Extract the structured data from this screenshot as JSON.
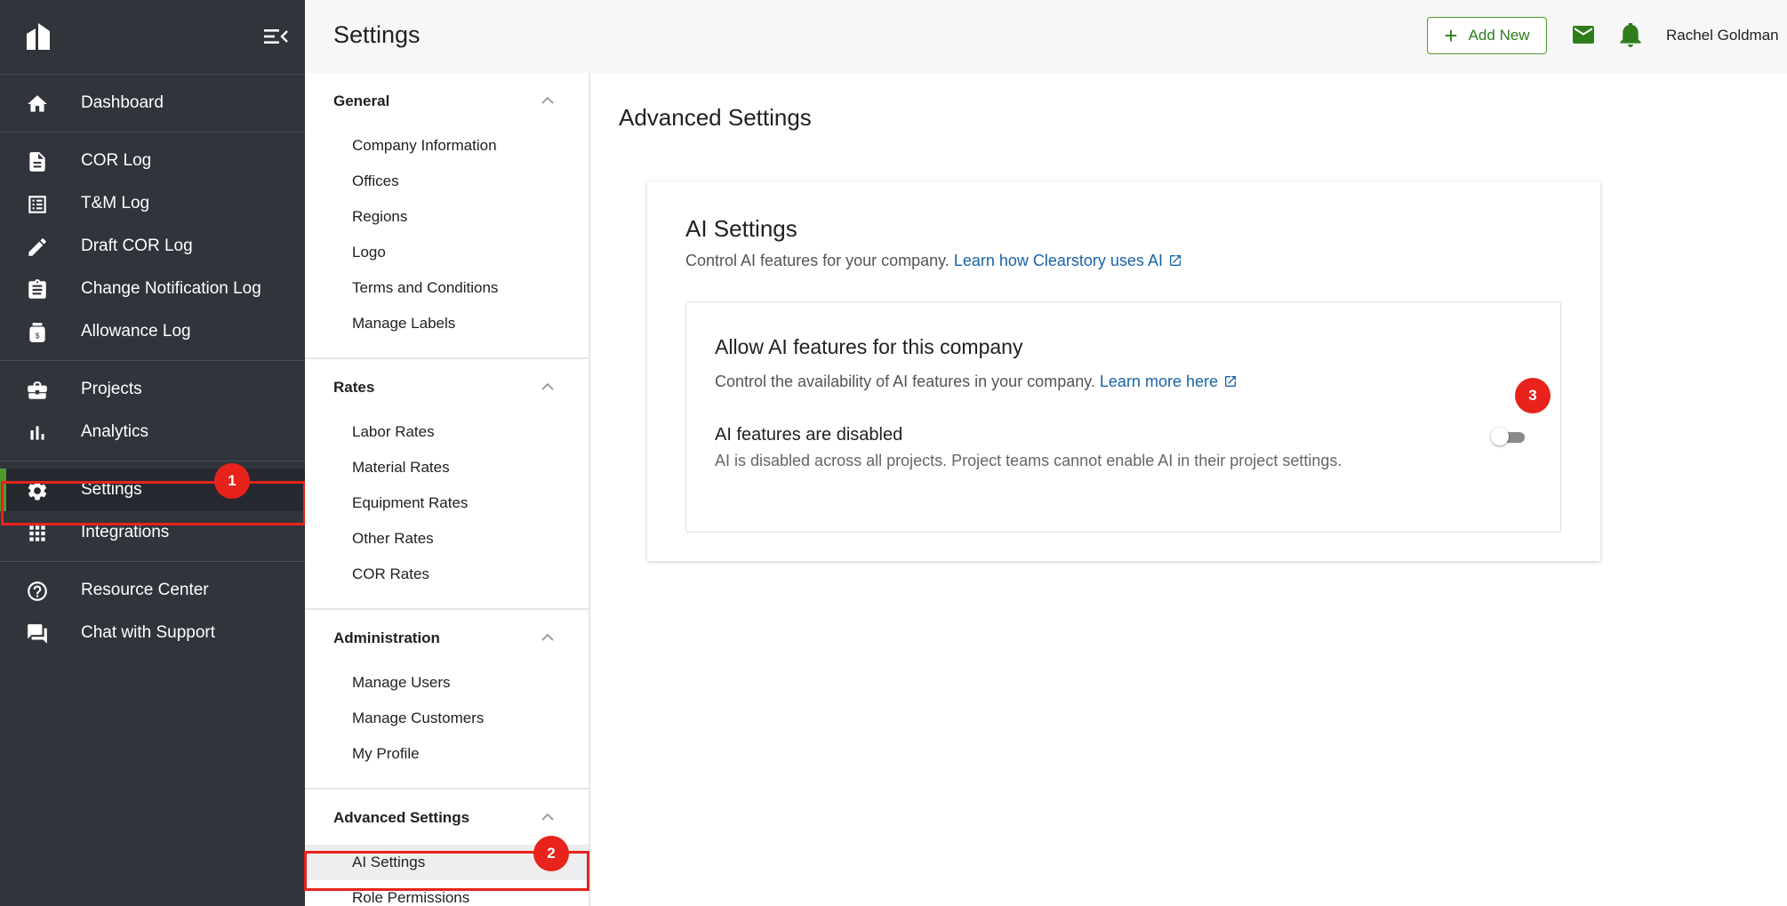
{
  "nav": {
    "groups": [
      [
        {
          "label": "Dashboard",
          "icon": "home-icon"
        }
      ],
      [
        {
          "label": "COR Log",
          "icon": "document-icon"
        },
        {
          "label": "T&M Log",
          "icon": "list-icon"
        },
        {
          "label": "Draft COR Log",
          "icon": "pencil-icon"
        },
        {
          "label": "Change Notification Log",
          "icon": "clipboard-icon"
        },
        {
          "label": "Allowance Log",
          "icon": "money-jar-icon"
        }
      ],
      [
        {
          "label": "Projects",
          "icon": "briefcase-icon"
        },
        {
          "label": "Analytics",
          "icon": "bar-chart-icon"
        }
      ],
      [
        {
          "label": "Settings",
          "icon": "gear-icon",
          "active": true
        },
        {
          "label": "Integrations",
          "icon": "grid-icon"
        }
      ],
      [
        {
          "label": "Resource Center",
          "icon": "help-icon"
        },
        {
          "label": "Chat with Support",
          "icon": "chat-icon"
        }
      ]
    ]
  },
  "markers": {
    "m1": "1",
    "m2": "2",
    "m3": "3"
  },
  "topbar": {
    "title": "Settings",
    "add_new": "Add New",
    "user_name": "Rachel Goldman"
  },
  "submenu": {
    "sections": [
      {
        "title": "General",
        "items": [
          "Company Information",
          "Offices",
          "Regions",
          "Logo",
          "Terms and Conditions",
          "Manage Labels"
        ]
      },
      {
        "title": "Rates",
        "items": [
          "Labor Rates",
          "Material Rates",
          "Equipment Rates",
          "Other Rates",
          "COR Rates"
        ]
      },
      {
        "title": "Administration",
        "items": [
          "Manage Users",
          "Manage Customers",
          "My Profile"
        ]
      },
      {
        "title": "Advanced Settings",
        "items": [
          "AI Settings",
          "Role Permissions"
        ]
      }
    ],
    "active_item": "AI Settings"
  },
  "main": {
    "title": "Advanced Settings",
    "card": {
      "title": "AI Settings",
      "desc": "Control AI features for your company.",
      "desc_link": "Learn how Clearstory uses AI",
      "inner": {
        "title": "Allow AI features for this company",
        "desc": "Control the availability of AI features in your company.",
        "desc_link": "Learn more here",
        "row_title": "AI features are disabled",
        "row_desc": "AI is disabled across all projects. Project teams cannot enable AI in their project settings.",
        "toggle_on": false
      }
    }
  },
  "colors": {
    "nav_bg": "#30343b",
    "accent_green": "#4f9a2f",
    "link_blue": "#1a63a6",
    "highlight_red": "#e8231b"
  }
}
